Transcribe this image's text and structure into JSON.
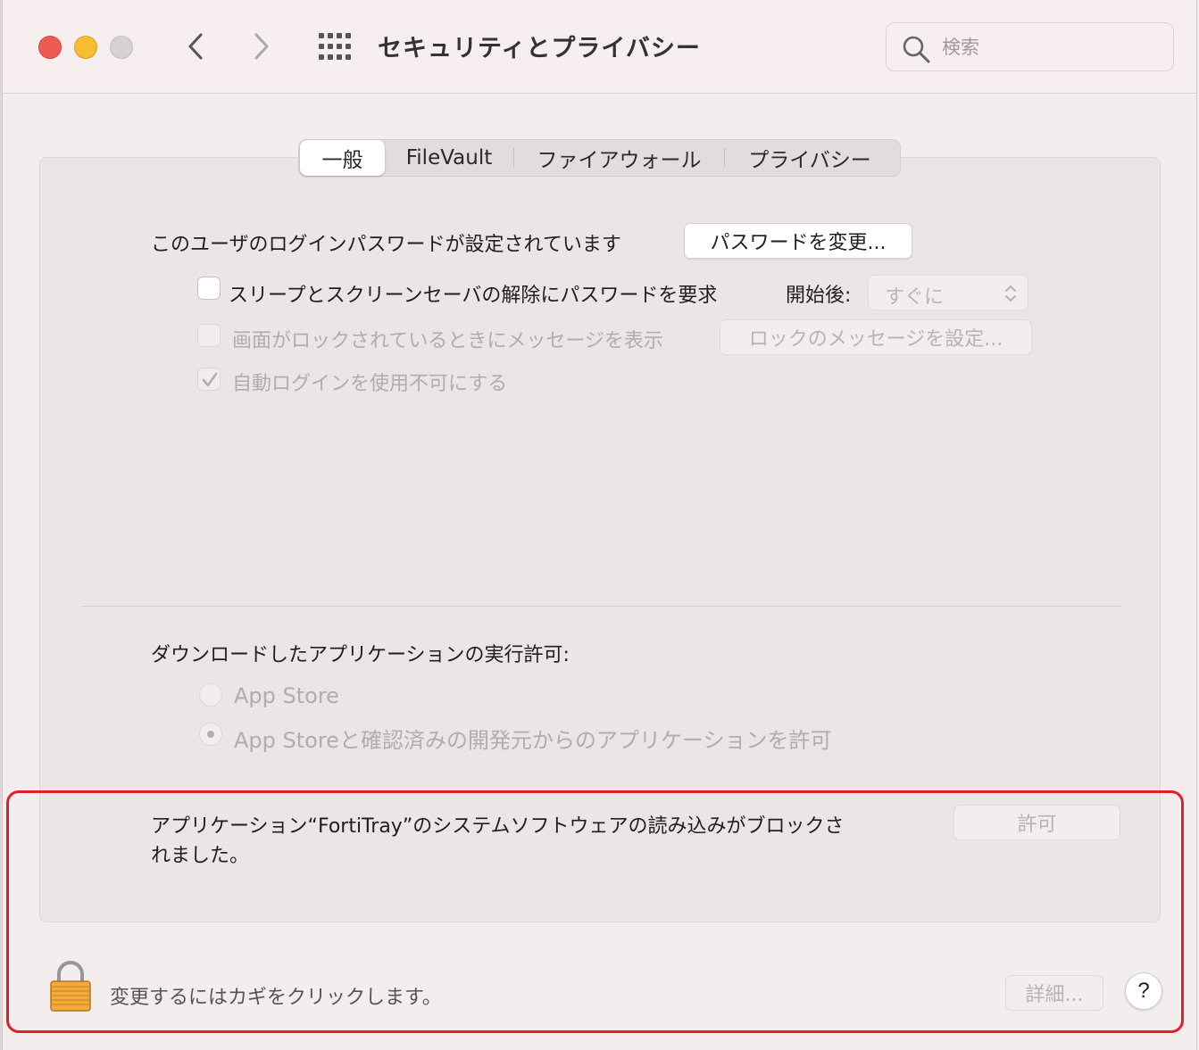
{
  "window": {
    "title": "セキュリティとプライバシー"
  },
  "search": {
    "placeholder": "検索"
  },
  "tabs": [
    {
      "label": "一般",
      "active": true
    },
    {
      "label": "FileVault",
      "active": false
    },
    {
      "label": "ファイアウォール",
      "active": false
    },
    {
      "label": "プライバシー",
      "active": false
    }
  ],
  "general": {
    "password_text": "このユーザのログインパスワードが設定されています",
    "change_password_button": "パスワードを変更...",
    "require_password_label": "スリープとスクリーンセーバの解除にパスワードを要求",
    "require_password_checked": false,
    "after_label": "開始後:",
    "after_value": "すぐに",
    "show_message_label": "画面がロックされているときにメッセージを表示",
    "show_message_checked": false,
    "set_message_button": "ロックのメッセージを設定...",
    "disable_auto_login_label": "自動ログインを使用不可にする",
    "disable_auto_login_checked": true
  },
  "downloads": {
    "heading": "ダウンロードしたアプリケーションの実行許可:",
    "options": [
      {
        "label": "App Store",
        "selected": false
      },
      {
        "label": "App Storeと確認済みの開発元からのアプリケーションを許可",
        "selected": true
      }
    ]
  },
  "blocked": {
    "message_line1": "アプリケーション“FortiTray”のシステムソフトウェアの読み込みがブロックさ",
    "message_line2": "れました。",
    "allow_button": "許可"
  },
  "footer": {
    "lock_text": "変更するにはカギをクリックします。",
    "advanced_button": "詳細...",
    "help_button": "?"
  },
  "colors": {
    "highlight": "#e0202b",
    "close": "#ee5b50",
    "minimize": "#f5bd2f"
  }
}
